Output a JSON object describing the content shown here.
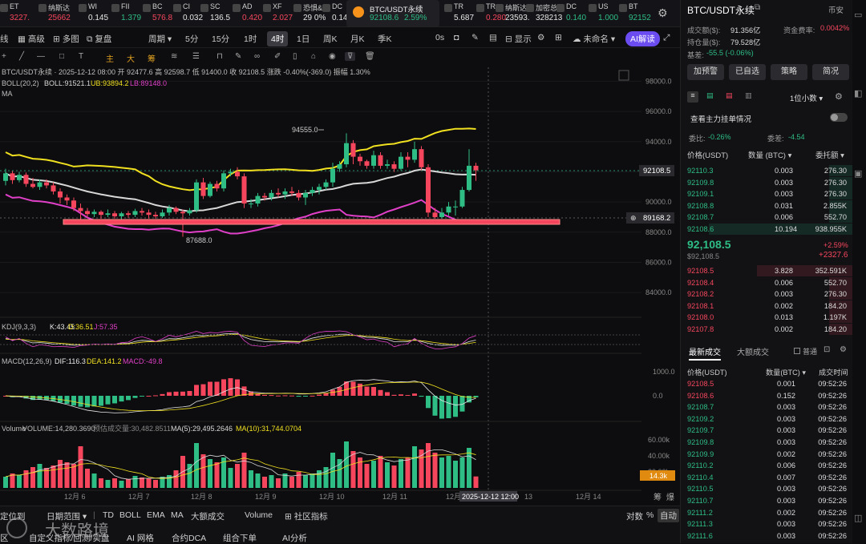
{
  "tickers": [
    {
      "name": "ET",
      "price": "3227.",
      "dir": "dn"
    },
    {
      "name": "纳斯达",
      "price": "25662",
      "dir": "dn"
    },
    {
      "name": "WI",
      "price": "0.145",
      "dir": "wh"
    },
    {
      "name": "FII",
      "price": "1.379",
      "dir": "up"
    },
    {
      "name": "BC",
      "price": "576.8",
      "dir": "dn"
    },
    {
      "name": "CI",
      "price": "0.032",
      "dir": "wh"
    },
    {
      "name": "SC",
      "price": "136.5",
      "dir": "wh"
    },
    {
      "name": "AD",
      "price": "0.420",
      "dir": "dn"
    },
    {
      "name": "XF",
      "price": "2.027",
      "dir": "dn"
    },
    {
      "name": "恐惧&",
      "price": "29 0%",
      "dir": "wh"
    },
    {
      "name": "DC",
      "price": "0.140",
      "dir": "wh"
    }
  ],
  "active_ticker": {
    "name": "BTC/USDT永续",
    "price": "92108.6",
    "change": "2.59%"
  },
  "tickers_right": [
    {
      "name": "TR",
      "price": "5.687",
      "dir": "wh"
    },
    {
      "name": "TR",
      "price": "0.280",
      "dir": "dn"
    },
    {
      "name": "纳斯达",
      "price": "23593.",
      "dir": "wh"
    },
    {
      "name": "加密总",
      "price": "328213",
      "dir": "wh"
    },
    {
      "name": "DC",
      "price": "0.140",
      "dir": "up"
    },
    {
      "name": "US",
      "price": "1.000",
      "dir": "up"
    },
    {
      "name": "BT",
      "price": "92152",
      "dir": "up"
    }
  ],
  "toolbar": {
    "advanced": "高级",
    "multi": "多图",
    "replay": "复盘",
    "period": "周期",
    "t5m": "5分",
    "t15m": "15分",
    "t1h": "1时",
    "t4h": "4时",
    "t1d": "1日",
    "t1w": "周K",
    "t1M": "月K",
    "t1q": "季K",
    "zero_s": "0s",
    "display": "显示",
    "unnamed": "未命名",
    "ai": "AI解读",
    "main": "主",
    "big": "大",
    "chip": "筹"
  },
  "chart": {
    "header": "BTC/USDT永续 · 2025-12-12 08:00 开 92477.6 高 92598.7 低 91400.0 收 92108.5 涨跌 -0.40%(-369.0) 振幅 1.30%",
    "boll_label": "BOLL(20,2)",
    "boll_mid": "BOLL:91521.1",
    "boll_ub": "UB:93894.2",
    "boll_lb": "LB:89148.0",
    "ma_label": "MA",
    "high_note": "94555.0",
    "low_note": "87688.0",
    "price_tag": "92108.5",
    "line_tag": "89168.2",
    "y_ticks": [
      "98000.0",
      "96000.0",
      "94000.0",
      "92000.0",
      "90000.0",
      "88000.0",
      "86000.0",
      "84000.0"
    ],
    "kdj": {
      "label": "KDJ(9,3,3)",
      "k": "K:43.45",
      "d": "D:36.51",
      "j": "J:57.35"
    },
    "macd": {
      "label": "MACD(12,26,9)",
      "dif": "DIF:116.3",
      "dea": "DEA:141.2",
      "macd": "MACD:-49.8",
      "ticks": [
        "1000.0",
        "0.0"
      ]
    },
    "vol": {
      "label": "Volume",
      "volume": "VOLUME:14,280.3690",
      "est": "预估成交量:30,482.8511",
      "ma5": "MA(5):29,495.2646",
      "ma10": "MA(10):31,744.0704",
      "ticks": [
        "60.00k",
        "40.00k",
        "20.00k"
      ],
      "current": "14.3k"
    },
    "x_labels": [
      "12月 6",
      "12月 7",
      "12月 8",
      "12月 9",
      "12月 10",
      "12月 11",
      "12月",
      "13",
      "12月 14"
    ],
    "cursor_date": "2025-12-12 12:00",
    "watermark": "大数路境"
  },
  "chart_data": {
    "type": "candlestick",
    "ylim": [
      83000,
      98500
    ],
    "candles": [
      [
        91400,
        91900,
        92200,
        91100
      ],
      [
        91900,
        91450,
        92050,
        91200
      ],
      [
        91450,
        91800,
        92000,
        91300
      ],
      [
        91800,
        91200,
        91950,
        91000
      ],
      [
        91200,
        91000,
        91600,
        90900
      ],
      [
        91000,
        91300,
        91500,
        90800
      ],
      [
        91300,
        91100,
        91500,
        90900
      ],
      [
        91100,
        90700,
        91300,
        90500
      ],
      [
        90700,
        90300,
        90900,
        89900
      ],
      [
        90300,
        90100,
        90500,
        89800
      ],
      [
        90100,
        89600,
        90300,
        89400
      ],
      [
        89600,
        89400,
        89900,
        88600
      ],
      [
        89400,
        89200,
        89600,
        89000
      ],
      [
        89200,
        89350,
        89500,
        89000
      ],
      [
        89350,
        89150,
        89450,
        88900
      ],
      [
        89150,
        89250,
        89500,
        89000
      ],
      [
        89250,
        89050,
        89400,
        88900
      ],
      [
        89050,
        89250,
        89350,
        88850
      ],
      [
        89250,
        89150,
        89400,
        88950
      ],
      [
        89150,
        89400,
        89550,
        89000
      ],
      [
        89400,
        89300,
        89600,
        89100
      ],
      [
        89300,
        89150,
        89500,
        88900
      ],
      [
        89150,
        89050,
        89350,
        88900
      ],
      [
        89050,
        89300,
        89500,
        88950
      ],
      [
        89300,
        89600,
        89800,
        89100
      ],
      [
        89600,
        89350,
        89700,
        89200
      ],
      [
        89350,
        89250,
        89500,
        87700
      ],
      [
        89250,
        89450,
        89600,
        89100
      ],
      [
        89450,
        91300,
        91500,
        89300
      ],
      [
        91300,
        90400,
        91600,
        90200
      ],
      [
        90400,
        91200,
        91350,
        90300
      ],
      [
        91200,
        90900,
        91400,
        90700
      ],
      [
        90900,
        91900,
        92100,
        90700
      ],
      [
        91900,
        92000,
        92200,
        91700
      ],
      [
        92000,
        91700,
        92300,
        91500
      ],
      [
        91700,
        89900,
        91900,
        89600
      ],
      [
        89900,
        89900,
        90200,
        89600
      ],
      [
        89900,
        90400,
        90600,
        89700
      ],
      [
        90400,
        90300,
        90600,
        90100
      ],
      [
        90300,
        90600,
        90800,
        90100
      ],
      [
        90600,
        90500,
        90900,
        90300
      ],
      [
        90500,
        90700,
        90900,
        90200
      ],
      [
        90700,
        90600,
        91000,
        90400
      ],
      [
        90600,
        90300,
        90800,
        90100
      ],
      [
        90300,
        90600,
        90800,
        89800
      ],
      [
        90600,
        90800,
        91000,
        90400
      ],
      [
        90800,
        91000,
        91200,
        90500
      ],
      [
        91000,
        91300,
        91500,
        90800
      ],
      [
        91300,
        92200,
        92600,
        91000
      ],
      [
        92200,
        92500,
        92700,
        92000
      ],
      [
        92500,
        93900,
        94555,
        92300
      ],
      [
        93900,
        93000,
        94100,
        92500
      ],
      [
        93000,
        92700,
        93200,
        92400
      ],
      [
        92700,
        92400,
        92800,
        92200
      ],
      [
        92400,
        93100,
        93400,
        92200
      ],
      [
        93100,
        92400,
        93300,
        92200
      ],
      [
        92400,
        92500,
        92800,
        92200
      ],
      [
        92500,
        92200,
        92700,
        92000
      ],
      [
        92200,
        93000,
        93300,
        92100
      ],
      [
        93000,
        92800,
        93300,
        92300
      ],
      [
        92800,
        93500,
        94000,
        92600
      ],
      [
        93500,
        92300,
        93700,
        92100
      ],
      [
        92300,
        89300,
        92500,
        89000
      ],
      [
        89300,
        89000,
        89600,
        88900
      ],
      [
        89000,
        89300,
        89600,
        88900
      ],
      [
        89300,
        89700,
        90000,
        89100
      ],
      [
        89700,
        89700,
        90100,
        89100
      ],
      [
        89700,
        90800,
        91000,
        89600
      ],
      [
        90800,
        92400,
        93500,
        90700
      ],
      [
        92400,
        92100,
        92600,
        91400
      ]
    ],
    "volume": [
      14000,
      18000,
      16000,
      22000,
      26000,
      30000,
      25000,
      28000,
      35000,
      32000,
      30000,
      52000,
      24000,
      18000,
      12000,
      10000,
      12000,
      9000,
      11000,
      15000,
      13000,
      12000,
      10000,
      14000,
      16000,
      22000,
      40000,
      30000,
      56000,
      42000,
      36000,
      32000,
      38000,
      25000,
      30000,
      44000,
      22000,
      18000,
      14000,
      16000,
      12000,
      18000,
      14000,
      20000,
      16000,
      18000,
      22000,
      26000,
      44000,
      36000,
      58000,
      46000,
      38000,
      30000,
      34000,
      40000,
      32000,
      28000,
      36000,
      38000,
      52000,
      48000,
      56000,
      44000,
      38000,
      40000,
      34000,
      38000,
      50000,
      14300
    ]
  },
  "sidebar": {
    "symbol": "BTC/USDT永续",
    "exchange": "币安",
    "turnover_label": "成交额($):",
    "turnover": "91.356亿",
    "funding_label": "资金费率:",
    "funding": "0.0042%",
    "oi_label": "持仓量($):",
    "oi": "79.528亿",
    "basis_label": "基差:",
    "basis": "-55.5 (-0.06%)",
    "buttons": [
      "加预警",
      "已自选",
      "策略",
      "简况"
    ],
    "interval": "1位小数",
    "big_orders": "查看主力挂单情况",
    "ratio_label": "委比:",
    "ratio": "-0.26%",
    "diff_label": "委差:",
    "diff": "-4.54",
    "ob_headers": [
      "价格(USDT)",
      "数量 (BTC)",
      "委托额"
    ],
    "asks": [
      [
        "92110.3",
        "0.003",
        "276.30"
      ],
      [
        "92109.8",
        "0.003",
        "276.30"
      ],
      [
        "92109.1",
        "0.003",
        "276.30"
      ],
      [
        "92108.8",
        "0.031",
        "2.855K"
      ],
      [
        "92108.7",
        "0.006",
        "552.70"
      ],
      [
        "92108.6",
        "10.194",
        "938.955K"
      ]
    ],
    "mid_price": "92,108.5",
    "mid_usd": "$92,108.5",
    "mid_pct": "+2.59%",
    "mid_abs": "+2327.6",
    "bids": [
      [
        "92108.5",
        "3.828",
        "352.591K"
      ],
      [
        "92108.4",
        "0.006",
        "552.70"
      ],
      [
        "92108.2",
        "0.003",
        "276.30"
      ],
      [
        "92108.1",
        "0.002",
        "184.20"
      ],
      [
        "92108.0",
        "0.013",
        "1.197K"
      ],
      [
        "92107.8",
        "0.002",
        "184.20"
      ]
    ],
    "trade_tabs": [
      "最新成交",
      "大额成交",
      "普通"
    ],
    "trade_headers": [
      "价格(USDT)",
      "数量(BTC)",
      "成交时间"
    ],
    "trades": [
      [
        "92108.5",
        "0.001",
        "09:52:26",
        "dn"
      ],
      [
        "92108.6",
        "0.152",
        "09:52:26",
        "dn"
      ],
      [
        "92108.7",
        "0.003",
        "09:52:26",
        "up"
      ],
      [
        "92109.2",
        "0.003",
        "09:52:26",
        "up"
      ],
      [
        "92109.7",
        "0.003",
        "09:52:26",
        "up"
      ],
      [
        "92109.8",
        "0.003",
        "09:52:26",
        "up"
      ],
      [
        "92109.9",
        "0.002",
        "09:52:26",
        "up"
      ],
      [
        "92110.2",
        "0.006",
        "09:52:26",
        "up"
      ],
      [
        "92110.4",
        "0.007",
        "09:52:26",
        "up"
      ],
      [
        "92110.5",
        "0.003",
        "09:52:26",
        "up"
      ],
      [
        "92110.7",
        "0.003",
        "09:52:26",
        "up"
      ],
      [
        "92111.2",
        "0.002",
        "09:52:26",
        "up"
      ],
      [
        "92111.3",
        "0.003",
        "09:52:26",
        "up"
      ],
      [
        "92111.6",
        "0.003",
        "09:52:26",
        "up"
      ]
    ]
  },
  "bottom": {
    "r1": [
      "定位到",
      "日期范围",
      "TD",
      "BOLL",
      "EMA",
      "MA",
      "大额成交",
      "Volume",
      "社区指标",
      "对数",
      "%",
      "自动"
    ],
    "r2": [
      "区",
      "自定义指标/回测/实盘",
      "AI 网格",
      "合约DCA",
      "组合下单",
      "AI分析"
    ],
    "right_labels": [
      "筹",
      "爆"
    ]
  },
  "colors": {
    "up": "#2ebd85",
    "down": "#f6465d",
    "boll_ub": "#f0e020",
    "boll_mid": "#d8d8d8",
    "boll_lb": "#e040c8"
  }
}
